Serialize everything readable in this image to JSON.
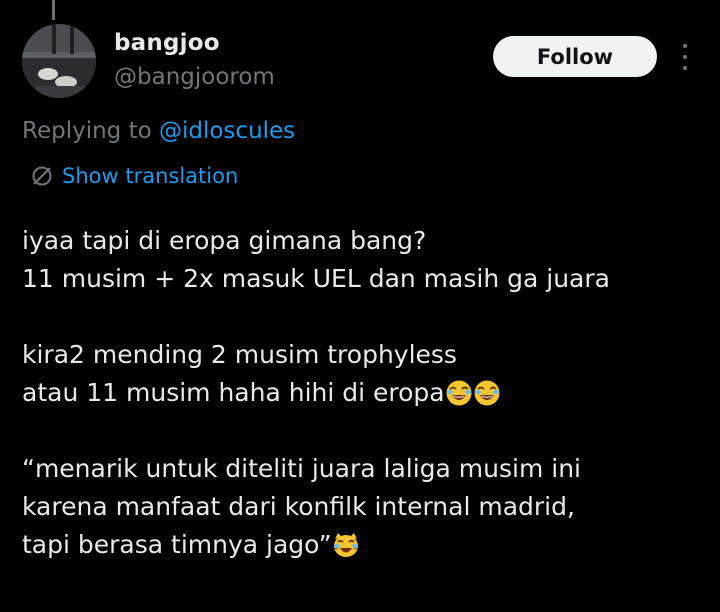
{
  "author": {
    "display_name": "bangjoo",
    "handle": "@bangjoorom"
  },
  "actions": {
    "follow_label": "Follow",
    "more_icon": "more-vertical-icon"
  },
  "reply": {
    "prefix": "Replying to ",
    "mention": "@idloscules"
  },
  "translation": {
    "label": "Show translation",
    "icon": "globe-icon"
  },
  "tweet": {
    "lines": [
      "iyaa tapi di eropa gimana bang?",
      "11 musim + 2x masuk UEL dan masih ga juara",
      "",
      "kira2 mending 2 musim trophyless",
      "atau 11 musim haha hihi di eropa",
      "",
      "“menarik untuk diteliti juara laliga musim ini",
      "karena manfaat dari konfilk internal madrid,",
      "tapi berasa timnya jago”"
    ],
    "emojis": {
      "line_5": [
        "laughing-face-emoji",
        "laughing-face-emoji"
      ],
      "line_9": [
        "crying-laughing-cat-emoji"
      ]
    }
  },
  "colors": {
    "background": "#000000",
    "text_primary": "#e7e9ea",
    "text_secondary": "#71767b",
    "accent_link": "#1d9bf0",
    "follow_bg": "#eff3f4"
  }
}
